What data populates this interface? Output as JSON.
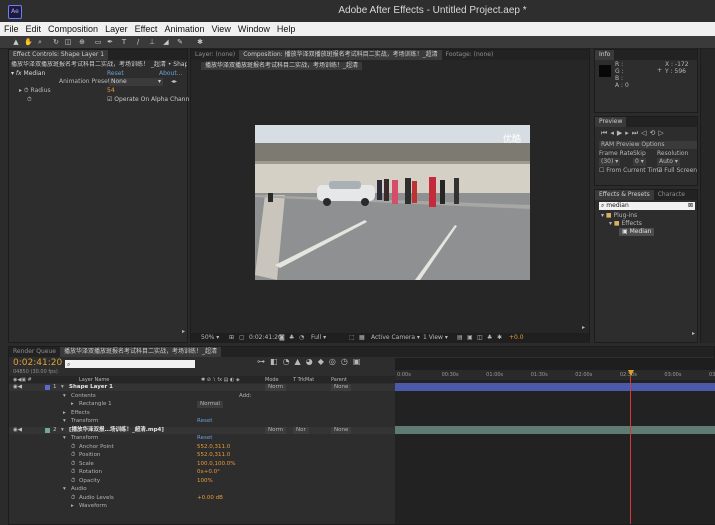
{
  "app": {
    "icon_text": "Ae",
    "title": "Adobe After Effects - Untitled Project.aep *"
  },
  "menu": [
    "File",
    "Edit",
    "Composition",
    "Layer",
    "Effect",
    "Animation",
    "View",
    "Window",
    "Help"
  ],
  "effect_controls": {
    "tab_title": "Effect Controls: Shape Layer 1",
    "header": "播放华泽双播放斑报名考试科目二实战，考场训练！ _超清 • Shape Layer 1",
    "effect_name": "Median",
    "reset_label": "Reset",
    "about_label": "About...",
    "presets_label": "Animation Presets:",
    "presets_value": "None",
    "radius_label": "Radius",
    "radius_value": "54",
    "alpha_label": "Operate On Alpha Chann"
  },
  "composition_panel": {
    "tabs": [
      "Layer: (none)",
      "Composition: 播放华泽双播放斑报名考试科目二实战，考场训练！_超清",
      "Footage: (none)"
    ],
    "breadcrumb": "播放华泽双播放斑报名考试科目二实战，考场训练！_超清",
    "watermark": "优酷",
    "controls": {
      "zoom": "50%",
      "timecode": "0:02:41:20",
      "resolution": "Full",
      "camera": "Active Camera",
      "view": "1 View",
      "exposure": "+0.0"
    }
  },
  "info_panel": {
    "tab": "Info",
    "r": "R :",
    "g": "G :",
    "b": "B :",
    "a": "A : 0",
    "x": "X : -172",
    "y": "Y : 596"
  },
  "preview_panel": {
    "tab": "Preview",
    "ram_label": "RAM Preview Options",
    "frame_rate_label": "Frame Rate",
    "skip_label": "Skip",
    "resolution_label": "Resolution",
    "frame_rate_value": "(30)",
    "skip_value": "0",
    "resolution_value": "Auto",
    "from_current": "From Current Time",
    "full_screen": "Full Screen"
  },
  "effects_presets": {
    "tabs": [
      "Effects & Presets",
      "Characte"
    ],
    "search": "median",
    "tree": [
      "Plug-ins",
      "Effects",
      "Median"
    ]
  },
  "timeline": {
    "tabs": [
      "Render Queue",
      "播放华泽双播放斑报名考试科目二实战，考场训练！_超清"
    ],
    "timecode": "0:02:41:20",
    "frame_info": "04850 (30.00 fps)",
    "columns": [
      "Layer Name",
      "Mode",
      "T TrkMat",
      "Parent"
    ],
    "ruler": [
      "0:00s",
      "00:30s",
      "01:00s",
      "01:30s",
      "02:00s",
      "02:30s",
      "03:00s",
      "03:30"
    ],
    "rows": [
      {
        "indent": 0,
        "num": "1",
        "name": "Shape Layer 1",
        "mode": "Norm",
        "parent": "None",
        "kind": "layer"
      },
      {
        "indent": 1,
        "name": "Contents",
        "extra": "Add:",
        "kind": "group"
      },
      {
        "indent": 2,
        "name": "Rectangle 1",
        "mode": "Normal",
        "kind": "prop"
      },
      {
        "indent": 1,
        "name": "Effects",
        "kind": "group"
      },
      {
        "indent": 1,
        "name": "Transform",
        "value": "Reset",
        "kind": "group"
      },
      {
        "indent": 0,
        "num": "2",
        "name": "[播放华泽双报…场训练！_超清.mp4]",
        "mode": "Norm",
        "trk": "Nor",
        "parent": "None",
        "kind": "layer"
      },
      {
        "indent": 1,
        "name": "Transform",
        "value": "Reset",
        "kind": "group"
      },
      {
        "indent": 2,
        "name": "Anchor Point",
        "value": "552.0,311.0",
        "kind": "prop"
      },
      {
        "indent": 2,
        "name": "Position",
        "value": "552.0,311.0",
        "kind": "prop"
      },
      {
        "indent": 2,
        "name": "Scale",
        "value": "100.0,100.0%",
        "kind": "prop"
      },
      {
        "indent": 2,
        "name": "Rotation",
        "value": "0x+0.0°",
        "kind": "prop"
      },
      {
        "indent": 2,
        "name": "Opacity",
        "value": "100%",
        "kind": "prop"
      },
      {
        "indent": 1,
        "name": "Audio",
        "kind": "group"
      },
      {
        "indent": 2,
        "name": "Audio Levels",
        "value": "+0.00 dB",
        "kind": "prop"
      },
      {
        "indent": 2,
        "name": "Waveform",
        "kind": "group"
      }
    ]
  },
  "colors": {
    "accent": "#e89a3c",
    "blue_link": "#6aa0d8",
    "layer1_bar": "#4a5aa8",
    "layer2_bar": "#5f7b74",
    "playhead": "#e0a020"
  }
}
